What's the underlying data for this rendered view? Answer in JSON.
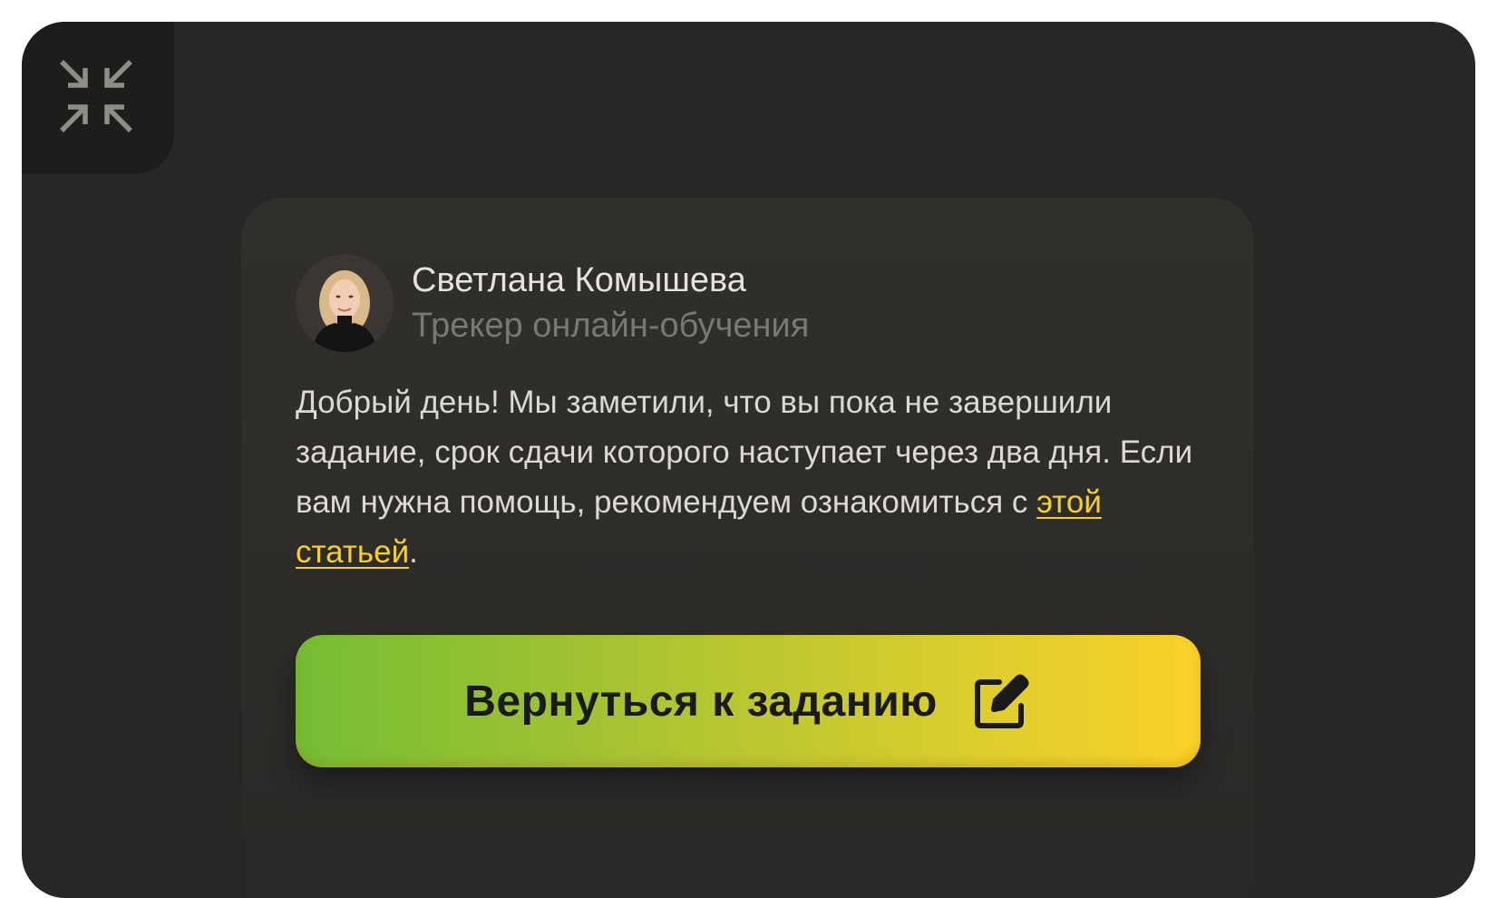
{
  "collapse": {
    "icon": "collapse-arrows-icon"
  },
  "author": {
    "name": "Светлана Комышева",
    "role": "Трекер онлайн-обучения",
    "avatar_icon": "avatar-photo"
  },
  "message": {
    "text_before": "Добрый день! Мы заметили, что вы пока не завершили задание, срок сдачи которого наступает через два дня. Если вам нужна помощь, рекомендуем ознакомиться с ",
    "link_text": "этой статьей",
    "text_after": "."
  },
  "cta": {
    "label": "Вернуться к заданию",
    "icon": "edit-icon"
  },
  "colors": {
    "background": "#282725",
    "card": "#302f2b",
    "link": "#f5cf2e",
    "button_gradient_start": "#74bd34",
    "button_gradient_end": "#fbd12a"
  }
}
